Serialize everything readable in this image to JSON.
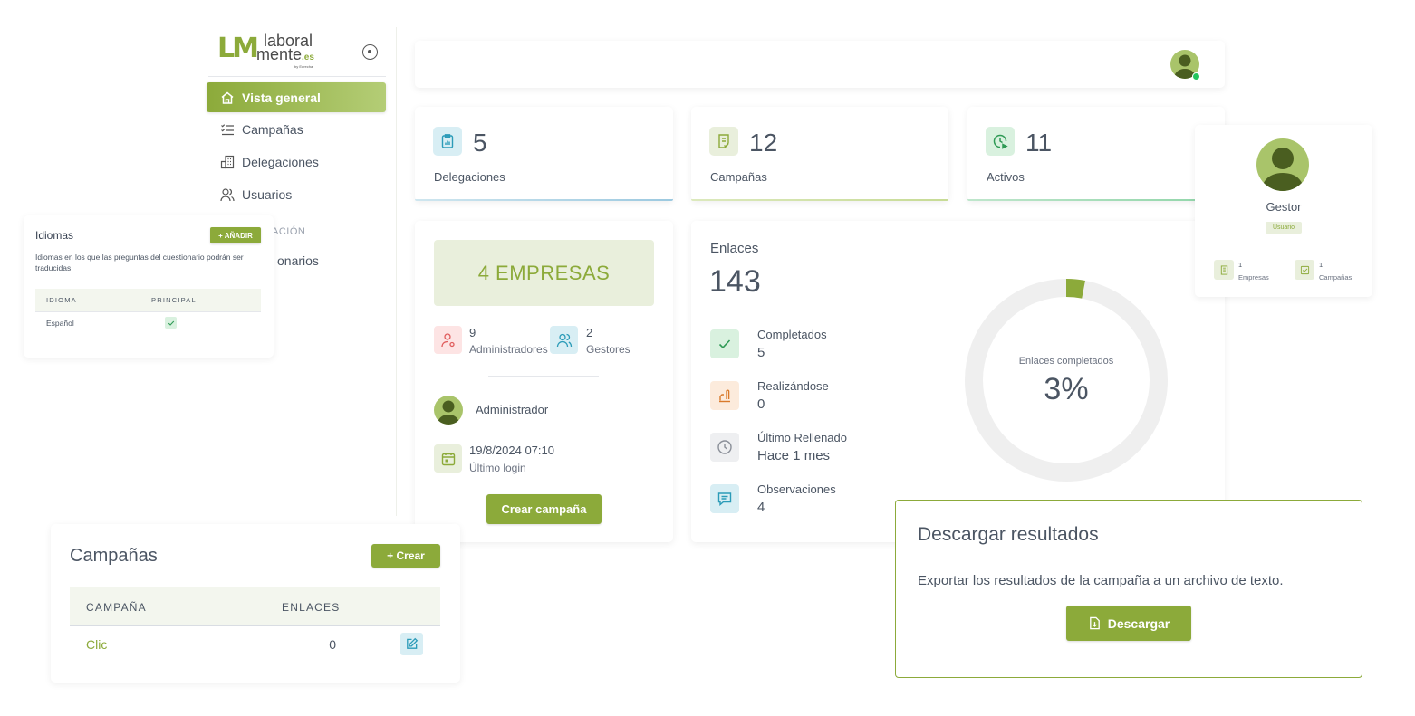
{
  "brand": {
    "mark": "LM",
    "line1": "laboral",
    "line2": "mente",
    "tld": ".es",
    "by": "by Eurecha"
  },
  "sidebar": {
    "items": [
      {
        "label": "Vista general",
        "icon": "home-icon",
        "active": true
      },
      {
        "label": "Campañas",
        "icon": "checklist-icon"
      },
      {
        "label": "Delegaciones",
        "icon": "building-icon"
      },
      {
        "label": "Usuarios",
        "icon": "users-icon"
      }
    ],
    "section_label": "ACIÓN",
    "partial_item": "onarios"
  },
  "stats": [
    {
      "value": "5",
      "label": "Delegaciones",
      "icon": "clipboard-chart-icon"
    },
    {
      "value": "12",
      "label": "Campañas",
      "icon": "document-check-icon"
    },
    {
      "value": "11",
      "label": "Activos",
      "icon": "clock-play-icon"
    }
  ],
  "company": {
    "banner": "4 EMPRESAS",
    "admins": {
      "value": "9",
      "label": "Administradores"
    },
    "managers": {
      "value": "2",
      "label": "Gestores"
    },
    "role": "Administrador",
    "last_login": {
      "value": "19/8/2024 07:10",
      "label": "Último login"
    },
    "create_button": "Crear campaña"
  },
  "enlaces": {
    "title": "Enlaces",
    "total": "143",
    "rows": [
      {
        "label": "Completados",
        "value": "5",
        "icon": "check-icon"
      },
      {
        "label": "Realizándose",
        "value": "0",
        "icon": "writing-hand-icon"
      },
      {
        "label": "Último Rellenado",
        "value": "Hace 1 mes",
        "icon": "clock-icon"
      },
      {
        "label": "Observaciones",
        "value": "4",
        "icon": "chat-icon"
      }
    ],
    "donut_label": "Enlaces completados",
    "donut_value": "3%",
    "donut_fraction": 0.03
  },
  "idiomas": {
    "title": "Idiomas",
    "add_button": "+ AÑADIR",
    "description": "Idiomas en los que las preguntas del cuestionario podrán ser traducidas.",
    "columns": [
      "IDIOMA",
      "PRINCIPAL"
    ],
    "rows": [
      {
        "idioma": "Español",
        "principal": true
      }
    ]
  },
  "profile": {
    "name": "Gestor",
    "badge": "Usuario",
    "stats": [
      {
        "value": "1",
        "label": "Empresas",
        "icon": "building-icon"
      },
      {
        "value": "1",
        "label": "Campañas",
        "icon": "checkbox-icon"
      }
    ]
  },
  "campanas": {
    "title": "Campañas",
    "create_button": "+ Crear",
    "columns": [
      "CAMPAÑA",
      "ENLACES"
    ],
    "rows": [
      {
        "name": "Clic",
        "links": "0"
      }
    ]
  },
  "descargar": {
    "title": "Descargar resultados",
    "description": "Exportar los resultados de la campaña a un archivo de texto.",
    "button": "Descargar"
  },
  "colors": {
    "accent": "#8caa3a",
    "accent_light": "#e9efdc",
    "online": "#22c55e"
  }
}
